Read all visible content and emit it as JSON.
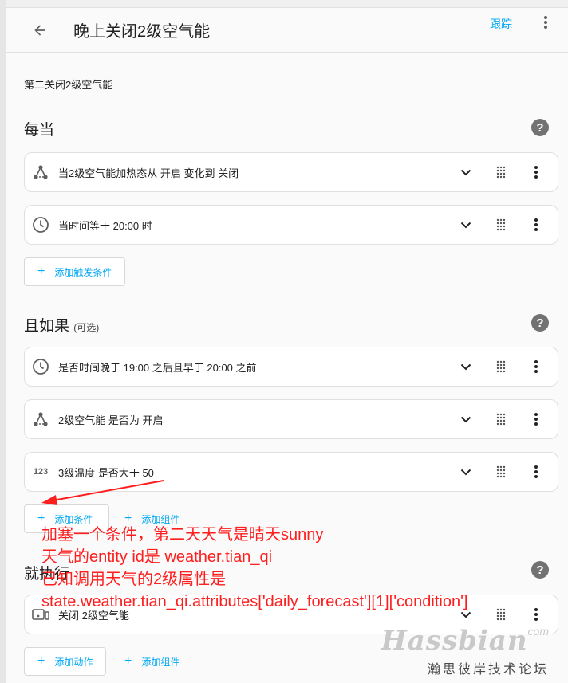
{
  "header": {
    "title": "晚上关闭2级空气能",
    "trace_label": "跟踪"
  },
  "description": "第二关闭2级空气能",
  "triggers": {
    "title": "每当",
    "items": [
      {
        "icon": "state-graph-icon",
        "text": "当2级空气能加热态从 开启 变化到 关闭"
      },
      {
        "icon": "clock-icon",
        "text": "当时间等于 20:00 时"
      }
    ],
    "add_label": "添加触发条件"
  },
  "conditions": {
    "title": "且如果",
    "optional": "(可选)",
    "items": [
      {
        "icon": "clock-icon",
        "text": "是否时间晚于 19:00 之后且早于 20:00 之前"
      },
      {
        "icon": "state-graph-icon",
        "text": "2级空气能 是否为 开启"
      },
      {
        "icon": "numeric-icon",
        "icon_text": "123",
        "text": "3级温度 是否大于 50"
      }
    ],
    "add_label": "添加条件",
    "add_block_label": "添加组件"
  },
  "actions": {
    "title": "就执行",
    "items": [
      {
        "icon": "device-icon",
        "text": "关闭 2级空气能"
      }
    ],
    "add_label": "添加动作",
    "add_block_label": "添加组件"
  },
  "annotation": {
    "lines": [
      "加塞一个条件，第二天天气是晴天sunny",
      "天气的entity id是 weather.tian_qi",
      "已知调用天气的2级属性是",
      "state.weather.tian_qi.attributes['daily_forecast'][1]['condition']"
    ],
    "color": "#ff1e1e"
  },
  "watermark": {
    "brand": "Hassbian",
    "suffix": "com",
    "subtitle": "瀚思彼岸技术论坛"
  },
  "colors": {
    "accent": "#03a9f4",
    "annotation": "#ff1e1e",
    "icon": "#5f5f5f"
  }
}
